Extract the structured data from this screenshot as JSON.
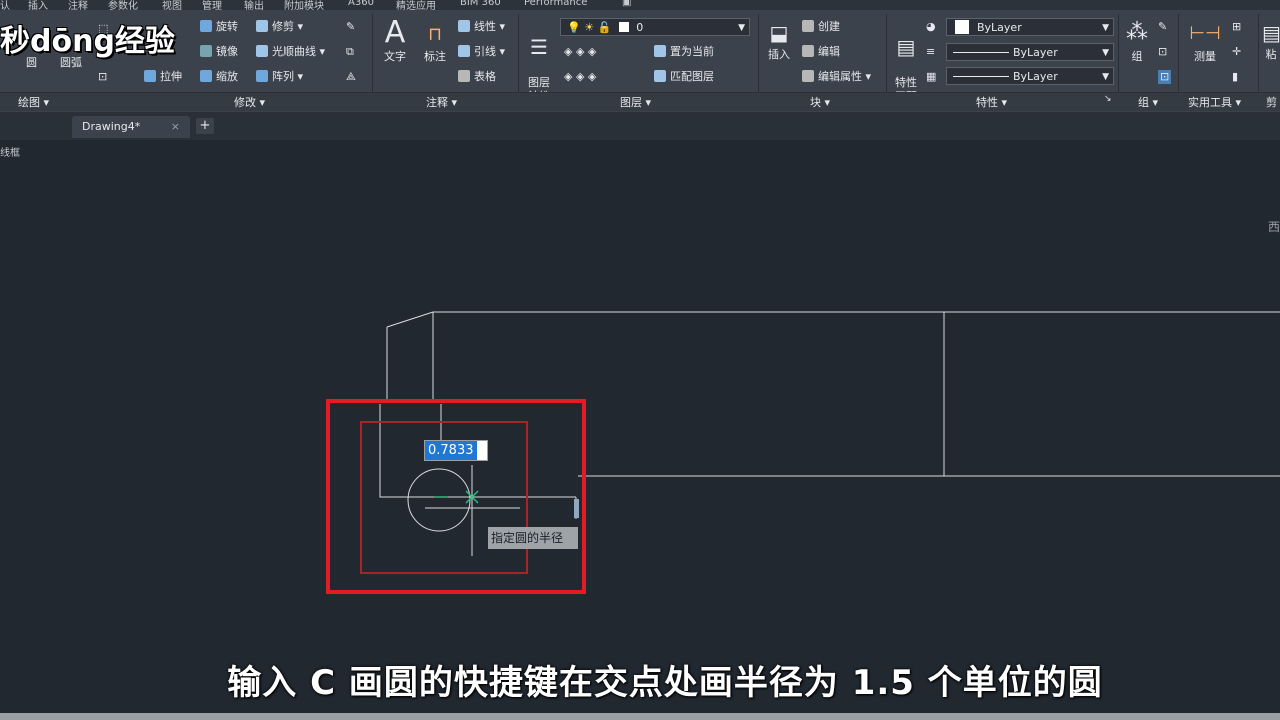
{
  "menu_tabs": [
    "认",
    "插入",
    "注释",
    "参数化",
    "视图",
    "管理",
    "输出",
    "附加模块",
    "A360",
    "精选应用",
    "BIM 360",
    "Performance"
  ],
  "logo": "秒dōng经验",
  "draw_panel": {
    "tools": [
      "圆",
      "圆弧"
    ],
    "label": "绘图"
  },
  "modify_panel": {
    "tools": [
      "旋转",
      "修剪",
      "镜像",
      "光顺曲线",
      "拉伸",
      "缩放",
      "阵列"
    ],
    "label": "修改"
  },
  "annotation_panel": {
    "text": "文字",
    "dim": "标注",
    "linear": "线性",
    "leader": "引线",
    "table": "表格",
    "label": "注释"
  },
  "layer_panel": {
    "props": "图层\n特性",
    "current_layer": "0",
    "set_current": "置为当前",
    "match": "匹配图层",
    "label": "图层"
  },
  "block_panel": {
    "insert": "插入",
    "create": "创建",
    "edit": "编辑",
    "edit_attr": "编辑属性",
    "label": "块"
  },
  "properties_panel": {
    "match": "特性\n匹配",
    "color": "ByLayer",
    "linetype": "ByLayer",
    "lineweight": "ByLayer",
    "label": "特性"
  },
  "group_panel": {
    "group": "组",
    "label": "组"
  },
  "utilities_panel": {
    "measure": "测量",
    "label": "实用工具"
  },
  "clipboard_panel": {
    "paste": "粘",
    "label": "剪"
  },
  "doc_tab": {
    "name": "Drawing4*",
    "close": "×",
    "new": "+"
  },
  "viewport_label": "线框",
  "viewcube_label": "西",
  "dynamic_input": {
    "value": "0.7833",
    "prompt": "指定圆的半径"
  },
  "subtitle": "输入 C 画圆的快捷键在交点处画半径为 1.5 个单位的圆",
  "colors": {
    "ribbon": "#3c424b",
    "canvas": "#212830",
    "highlight_box": "#e31b23",
    "input_selection": "#1f78d1"
  }
}
